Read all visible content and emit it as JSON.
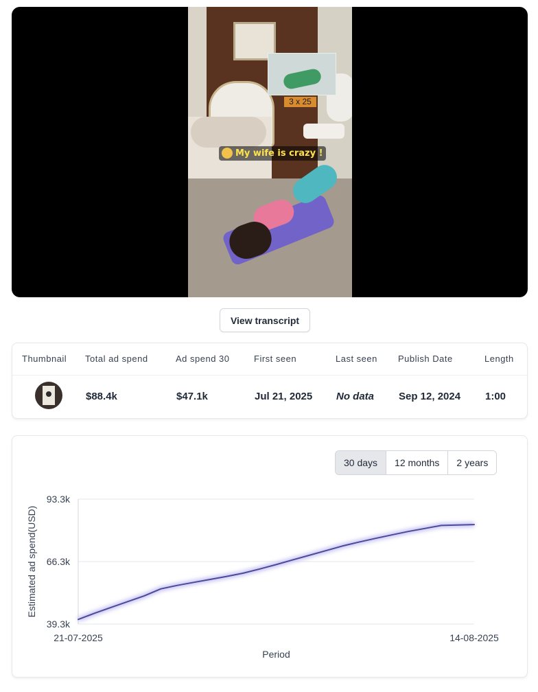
{
  "video": {
    "overlay_badge": "3 x 25",
    "caption": "My wife is crazy !"
  },
  "transcript_button": "View transcript",
  "stats": {
    "headers": {
      "thumbnail": "Thumbnail",
      "total_ad_spend": "Total ad spend",
      "ad_spend_30": "Ad spend 30",
      "first_seen": "First seen",
      "last_seen": "Last seen",
      "publish_date": "Publish Date",
      "length": "Length"
    },
    "values": {
      "total_ad_spend": "$88.4k",
      "ad_spend_30": "$47.1k",
      "first_seen": "Jul 21, 2025",
      "last_seen": "No data",
      "publish_date": "Sep 12, 2024",
      "length": "1:00"
    }
  },
  "range_buttons": {
    "days30": "30 days",
    "months12": "12 months",
    "years2": "2 years",
    "selected": "30 days"
  },
  "chart_data": {
    "type": "line",
    "ylabel": "Estimated ad spend(USD)",
    "xlabel": "Period",
    "x_ticks": [
      "21-07-2025",
      "14-08-2025"
    ],
    "y_ticks": [
      "39.3k",
      "66.3k",
      "93.3k"
    ],
    "ylim": [
      39300,
      93300
    ],
    "x": [
      "21-07-2025",
      "22-07-2025",
      "23-07-2025",
      "24-07-2025",
      "25-07-2025",
      "26-07-2025",
      "27-07-2025",
      "28-07-2025",
      "29-07-2025",
      "30-07-2025",
      "31-07-2025",
      "01-08-2025",
      "02-08-2025",
      "03-08-2025",
      "04-08-2025",
      "05-08-2025",
      "06-08-2025",
      "07-08-2025",
      "08-08-2025",
      "09-08-2025",
      "10-08-2025",
      "11-08-2025",
      "12-08-2025",
      "13-08-2025",
      "14-08-2025"
    ],
    "series": [
      {
        "color": "#4b4a99",
        "values": [
          41300,
          44000,
          46500,
          49000,
          51500,
          54500,
          56000,
          57300,
          58600,
          59900,
          61300,
          63100,
          65000,
          67000,
          69000,
          71000,
          73000,
          74700,
          76300,
          77800,
          79300,
          80600,
          81900,
          82100,
          82300
        ]
      }
    ],
    "grid": true,
    "legend": "none"
  }
}
